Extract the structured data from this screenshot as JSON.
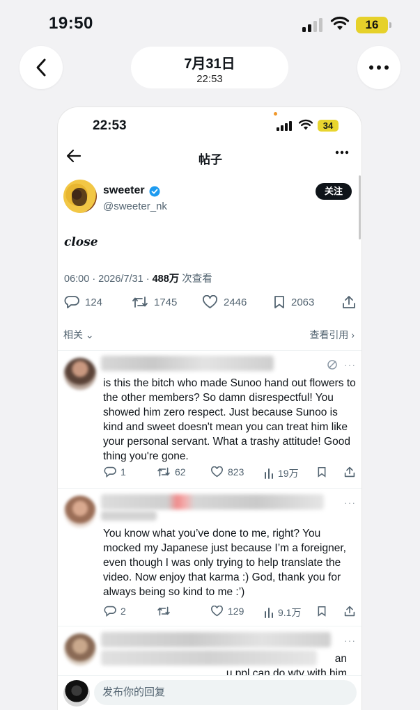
{
  "outer_status": {
    "time": "19:50",
    "battery": "16"
  },
  "outer_nav": {
    "date": "7月31日",
    "time": "22:53"
  },
  "inner_status": {
    "time": "22:53",
    "battery": "34"
  },
  "topbar": {
    "title": "帖子"
  },
  "author": {
    "name": "sweeter",
    "handle": "@sweeter_nk",
    "follow_label": "关注"
  },
  "post": {
    "text": "close",
    "time_date": "06:00 · 2026/7/31 · ",
    "views": "488万",
    "views_label": " 次查看"
  },
  "actions": {
    "replies": "124",
    "reposts": "1745",
    "likes": "2446",
    "bookmarks": "2063"
  },
  "related": {
    "left_label": "相关",
    "right_label": "查看引用"
  },
  "replies": [
    {
      "text": "is this the bitch who made Sunoo hand out flowers to the other members? So damn disrespectful! You showed him zero respect. Just because Sunoo is kind and sweet doesn't mean you can treat him like your personal servant. What a trashy attitude! Good thing you're gone.",
      "replies": "1",
      "reposts": "62",
      "likes": "823",
      "views": "19万"
    },
    {
      "text": "You know what you’ve done to me, right? You mocked my Japanese just because I’m a foreigner, even though I was only trying to help translate the video. Now enjoy that karma :) God, thank you for always being so kind to me :’)",
      "replies": "2",
      "reposts": "",
      "likes": "129",
      "views": "9.1万"
    },
    {
      "text": "an\nu ppl can do wtv with him",
      "replies": "",
      "reposts": "",
      "likes": "",
      "views": ""
    }
  ],
  "composer": {
    "placeholder": "发布你的回复"
  },
  "colors": {
    "text": "#0f1419",
    "secondary": "#536471",
    "verified": "#1d9bf0",
    "battery": "#e6d12a"
  }
}
